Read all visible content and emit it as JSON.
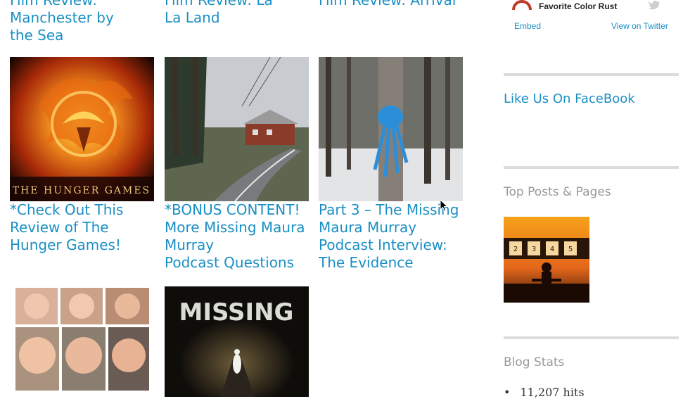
{
  "top_titles": {
    "col1": [
      "Film Review:",
      "Manchester by",
      "the Sea"
    ],
    "col2": [
      "Film Review: La",
      "La Land"
    ],
    "col3": [
      "Film Review: Arrival"
    ]
  },
  "posts": [
    {
      "title": "*Check Out This Review of The Hunger Games!",
      "lines": [
        "*Check Out This",
        "Review of The",
        "Hunger Games!"
      ],
      "image_text": "THE HUNGER GAMES"
    },
    {
      "title": "*BONUS CONTENT! More Missing Maura Murray Podcast Questions",
      "lines": [
        "*BONUS CONTENT!",
        "More Missing Maura",
        "Murray",
        "Podcast Questions"
      ]
    },
    {
      "title": "Part 3 – The Missing Maura Murray Podcast Interview: The Evidence",
      "lines": [
        "Part 3 – The Missing",
        "Maura Murray",
        "Podcast Interview:",
        "The Evidence"
      ]
    },
    {
      "title": "",
      "lines": []
    },
    {
      "title": "",
      "lines": [],
      "image_text": "MISSING"
    }
  ],
  "sidebar": {
    "twitter": {
      "account": "Favorite Color Rust",
      "embed": "Embed",
      "view": "View on Twitter"
    },
    "facebook_link": "Like Us On FaceBook",
    "top_posts_heading": "Top Posts & Pages",
    "top_post_image_numbers": [
      "2",
      "3",
      "4",
      "5"
    ],
    "blog_stats_heading": "Blog Stats",
    "stats": [
      "11,207 hits"
    ]
  },
  "colors": {
    "link": "#1a8fc4",
    "heading": "#9a9a9a",
    "rule": "#dcdcdc"
  }
}
